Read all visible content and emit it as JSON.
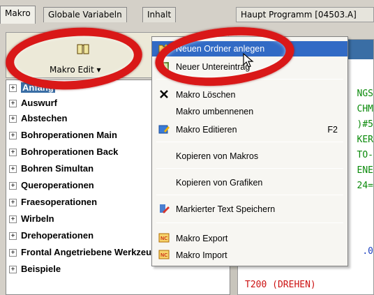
{
  "tabs": [
    "Makro",
    "Globale Variabeln",
    "Inhalt"
  ],
  "right_title": "Haupt Programm [04503.A]",
  "toolbar": {
    "macro_edit_label": "Makro Edit ▾",
    "macro_icon": "book-icon"
  },
  "tree": [
    {
      "label": "Anfang",
      "selected": true
    },
    {
      "label": "Auswurf"
    },
    {
      "label": "Abstechen"
    },
    {
      "label": "Bohroperationen Main"
    },
    {
      "label": "Bohroperationen Back"
    },
    {
      "label": "Bohren Simultan"
    },
    {
      "label": "Queroperationen"
    },
    {
      "label": "Fraesoperationen"
    },
    {
      "label": "Wirbeln"
    },
    {
      "label": "Drehoperationen"
    },
    {
      "label": "Frontal Angetriebene Werkzeuge"
    },
    {
      "label": "Beispiele"
    }
  ],
  "context_menu": {
    "items": [
      {
        "label": "Neuen Ordner anlegen",
        "icon": "new-folder-icon",
        "highlighted": true
      },
      {
        "label": "Neuer Untereintrag",
        "icon": "new-subentry-icon"
      },
      {
        "label": "Makro Löschen",
        "icon": "delete-x-icon"
      },
      {
        "label": "Makro umbennenen",
        "icon": ""
      },
      {
        "label": "Makro Editieren",
        "icon": "edit-icon",
        "shortcut": "F2"
      },
      {
        "label": "Kopieren von Makros",
        "icon": ""
      },
      {
        "label": "Kopieren von Grafiken",
        "icon": ""
      },
      {
        "label": "Markierter Text Speichern",
        "icon": "save-text-icon"
      },
      {
        "label": "Makro Export",
        "icon": "export-icon"
      },
      {
        "label": "Makro Import",
        "icon": "import-icon"
      }
    ]
  },
  "code_lines": [
    {
      "text": "NGS",
      "color": "#0a8a0a"
    },
    {
      "text": "CHM",
      "color": "#0a8a0a"
    },
    {
      "text": ")#5",
      "color": "#0a8a0a"
    },
    {
      "text": "KER",
      "color": "#0a8a0a"
    },
    {
      "text": "TO-",
      "color": "#0a8a0a"
    },
    {
      "text": "ENE",
      "color": "#0a8a0a"
    },
    {
      "text": "24=",
      "color": "#0a8a0a"
    },
    {
      "text": ".0",
      "color": "#1a3fbf"
    },
    {
      "text": "T200 (DREHEN)",
      "color": "#cc1111"
    }
  ],
  "colors": {
    "highlight": "#316ac5",
    "annotation_ring": "#d91818"
  }
}
